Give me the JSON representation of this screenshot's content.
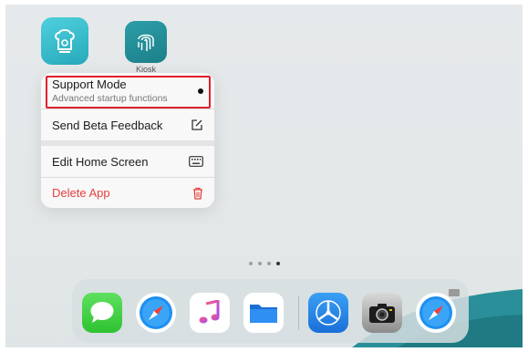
{
  "home": {
    "apps": [
      {
        "name": "chef-app",
        "label": ""
      },
      {
        "name": "kiosk-app",
        "label": "Kiosk"
      }
    ],
    "page_count": 4,
    "active_page": 4
  },
  "context_menu": {
    "items": [
      {
        "title": "Support Mode",
        "subtitle": "Advanced startup functions",
        "icon": "dot-icon"
      },
      {
        "title": "Send Beta Feedback",
        "icon": "compose-icon"
      },
      {
        "title": "Edit Home Screen",
        "icon": "keyboard-icon"
      },
      {
        "title": "Delete App",
        "icon": "trash-icon"
      }
    ]
  },
  "dock": {
    "apps": [
      "messages",
      "safari",
      "music",
      "files",
      "testflight",
      "camera",
      "safari"
    ]
  },
  "colors": {
    "destructive": "#e5413e",
    "highlight": "#e0202d",
    "teal": "#2aaebf"
  }
}
